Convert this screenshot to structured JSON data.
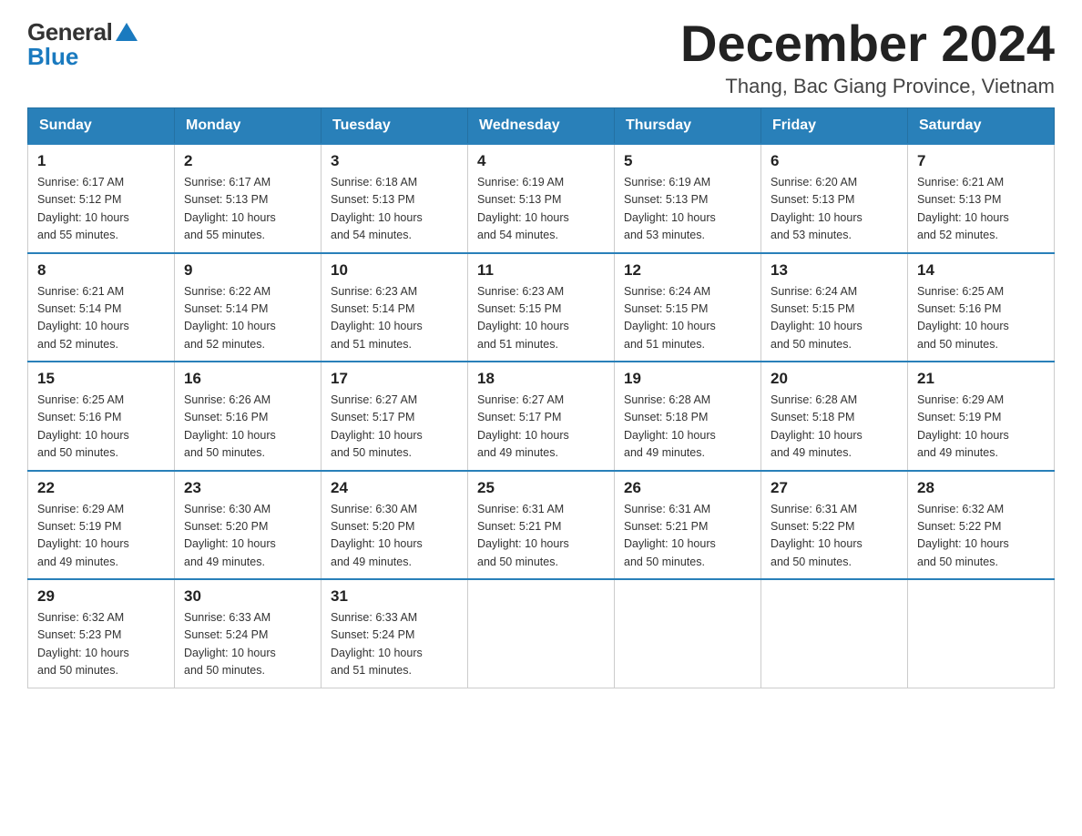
{
  "logo": {
    "general": "General",
    "blue": "Blue"
  },
  "header": {
    "title": "December 2024",
    "location": "Thang, Bac Giang Province, Vietnam"
  },
  "days": [
    "Sunday",
    "Monday",
    "Tuesday",
    "Wednesday",
    "Thursday",
    "Friday",
    "Saturday"
  ],
  "weeks": [
    [
      {
        "day": 1,
        "sunrise": "6:17 AM",
        "sunset": "5:12 PM",
        "daylight": "10 hours and 55 minutes."
      },
      {
        "day": 2,
        "sunrise": "6:17 AM",
        "sunset": "5:13 PM",
        "daylight": "10 hours and 55 minutes."
      },
      {
        "day": 3,
        "sunrise": "6:18 AM",
        "sunset": "5:13 PM",
        "daylight": "10 hours and 54 minutes."
      },
      {
        "day": 4,
        "sunrise": "6:19 AM",
        "sunset": "5:13 PM",
        "daylight": "10 hours and 54 minutes."
      },
      {
        "day": 5,
        "sunrise": "6:19 AM",
        "sunset": "5:13 PM",
        "daylight": "10 hours and 53 minutes."
      },
      {
        "day": 6,
        "sunrise": "6:20 AM",
        "sunset": "5:13 PM",
        "daylight": "10 hours and 53 minutes."
      },
      {
        "day": 7,
        "sunrise": "6:21 AM",
        "sunset": "5:13 PM",
        "daylight": "10 hours and 52 minutes."
      }
    ],
    [
      {
        "day": 8,
        "sunrise": "6:21 AM",
        "sunset": "5:14 PM",
        "daylight": "10 hours and 52 minutes."
      },
      {
        "day": 9,
        "sunrise": "6:22 AM",
        "sunset": "5:14 PM",
        "daylight": "10 hours and 52 minutes."
      },
      {
        "day": 10,
        "sunrise": "6:23 AM",
        "sunset": "5:14 PM",
        "daylight": "10 hours and 51 minutes."
      },
      {
        "day": 11,
        "sunrise": "6:23 AM",
        "sunset": "5:15 PM",
        "daylight": "10 hours and 51 minutes."
      },
      {
        "day": 12,
        "sunrise": "6:24 AM",
        "sunset": "5:15 PM",
        "daylight": "10 hours and 51 minutes."
      },
      {
        "day": 13,
        "sunrise": "6:24 AM",
        "sunset": "5:15 PM",
        "daylight": "10 hours and 50 minutes."
      },
      {
        "day": 14,
        "sunrise": "6:25 AM",
        "sunset": "5:16 PM",
        "daylight": "10 hours and 50 minutes."
      }
    ],
    [
      {
        "day": 15,
        "sunrise": "6:25 AM",
        "sunset": "5:16 PM",
        "daylight": "10 hours and 50 minutes."
      },
      {
        "day": 16,
        "sunrise": "6:26 AM",
        "sunset": "5:16 PM",
        "daylight": "10 hours and 50 minutes."
      },
      {
        "day": 17,
        "sunrise": "6:27 AM",
        "sunset": "5:17 PM",
        "daylight": "10 hours and 50 minutes."
      },
      {
        "day": 18,
        "sunrise": "6:27 AM",
        "sunset": "5:17 PM",
        "daylight": "10 hours and 49 minutes."
      },
      {
        "day": 19,
        "sunrise": "6:28 AM",
        "sunset": "5:18 PM",
        "daylight": "10 hours and 49 minutes."
      },
      {
        "day": 20,
        "sunrise": "6:28 AM",
        "sunset": "5:18 PM",
        "daylight": "10 hours and 49 minutes."
      },
      {
        "day": 21,
        "sunrise": "6:29 AM",
        "sunset": "5:19 PM",
        "daylight": "10 hours and 49 minutes."
      }
    ],
    [
      {
        "day": 22,
        "sunrise": "6:29 AM",
        "sunset": "5:19 PM",
        "daylight": "10 hours and 49 minutes."
      },
      {
        "day": 23,
        "sunrise": "6:30 AM",
        "sunset": "5:20 PM",
        "daylight": "10 hours and 49 minutes."
      },
      {
        "day": 24,
        "sunrise": "6:30 AM",
        "sunset": "5:20 PM",
        "daylight": "10 hours and 49 minutes."
      },
      {
        "day": 25,
        "sunrise": "6:31 AM",
        "sunset": "5:21 PM",
        "daylight": "10 hours and 50 minutes."
      },
      {
        "day": 26,
        "sunrise": "6:31 AM",
        "sunset": "5:21 PM",
        "daylight": "10 hours and 50 minutes."
      },
      {
        "day": 27,
        "sunrise": "6:31 AM",
        "sunset": "5:22 PM",
        "daylight": "10 hours and 50 minutes."
      },
      {
        "day": 28,
        "sunrise": "6:32 AM",
        "sunset": "5:22 PM",
        "daylight": "10 hours and 50 minutes."
      }
    ],
    [
      {
        "day": 29,
        "sunrise": "6:32 AM",
        "sunset": "5:23 PM",
        "daylight": "10 hours and 50 minutes."
      },
      {
        "day": 30,
        "sunrise": "6:33 AM",
        "sunset": "5:24 PM",
        "daylight": "10 hours and 50 minutes."
      },
      {
        "day": 31,
        "sunrise": "6:33 AM",
        "sunset": "5:24 PM",
        "daylight": "10 hours and 51 minutes."
      },
      null,
      null,
      null,
      null
    ]
  ],
  "labels": {
    "sunrise": "Sunrise:",
    "sunset": "Sunset:",
    "daylight": "Daylight:"
  }
}
